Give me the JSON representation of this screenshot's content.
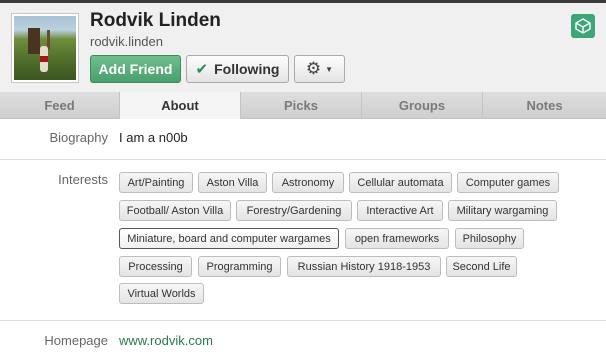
{
  "profile": {
    "display_name": "Rodvik Linden",
    "username": "rodvik.linden"
  },
  "actions": {
    "add_friend": "Add Friend",
    "following": "Following"
  },
  "tabs": [
    {
      "label": "Feed",
      "active": false
    },
    {
      "label": "About",
      "active": true
    },
    {
      "label": "Picks",
      "active": false
    },
    {
      "label": "Groups",
      "active": false
    },
    {
      "label": "Notes",
      "active": false
    }
  ],
  "biography": {
    "label": "Biography",
    "text": "I am a n00b"
  },
  "interests": {
    "label": "Interests",
    "items": [
      "Art/Painting",
      "Aston Villa",
      "Astronomy",
      "Cellular automata",
      "Computer games",
      "Football/ Aston Villa",
      "Forestry/Gardening",
      "Interactive Art",
      "Military wargaming",
      "Miniature, board and computer wargames",
      "open frameworks",
      "Philosophy",
      "Processing",
      "Programming",
      "Russian History 1918-1953",
      "Second Life",
      "Virtual Worlds"
    ],
    "highlighted_index": 9
  },
  "homepage": {
    "label": "Homepage",
    "url": "www.rodvik.com"
  },
  "icons": {
    "check": "check-icon",
    "gear": "gear-icon",
    "dropdown": "chevron-down-icon",
    "app": "second-life-cube-icon"
  },
  "colors": {
    "accent_green": "#4a9f6c",
    "link_green": "#2b7a4b",
    "header_bg": "#f0f0f0"
  }
}
